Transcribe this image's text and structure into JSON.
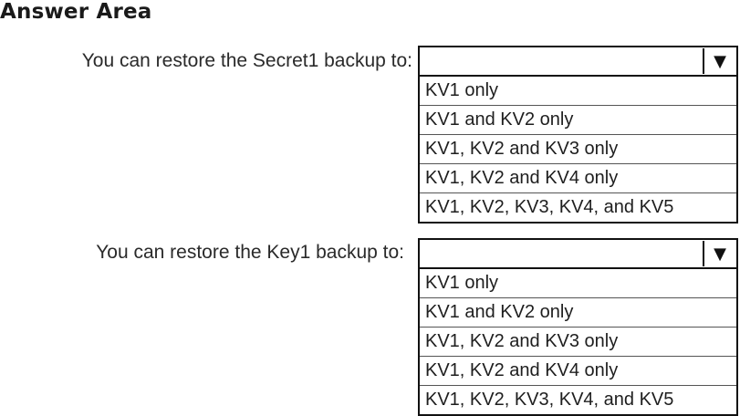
{
  "title": "Answer Area",
  "questions": [
    {
      "label": "You can restore the Secret1 backup to:",
      "selected": "",
      "arrow_icon": "▼",
      "options": [
        "KV1 only",
        "KV1 and KV2 only",
        "KV1, KV2 and KV3 only",
        "KV1, KV2 and KV4 only",
        "KV1, KV2, KV3, KV4, and KV5"
      ]
    },
    {
      "label": "You can restore the Key1 backup to:",
      "selected": "",
      "arrow_icon": "▼",
      "options": [
        "KV1 only",
        "KV1 and KV2 only",
        "KV1, KV2 and KV3 only",
        "KV1, KV2 and KV4 only",
        "KV1, KV2, KV3, KV4, and KV5"
      ]
    }
  ]
}
